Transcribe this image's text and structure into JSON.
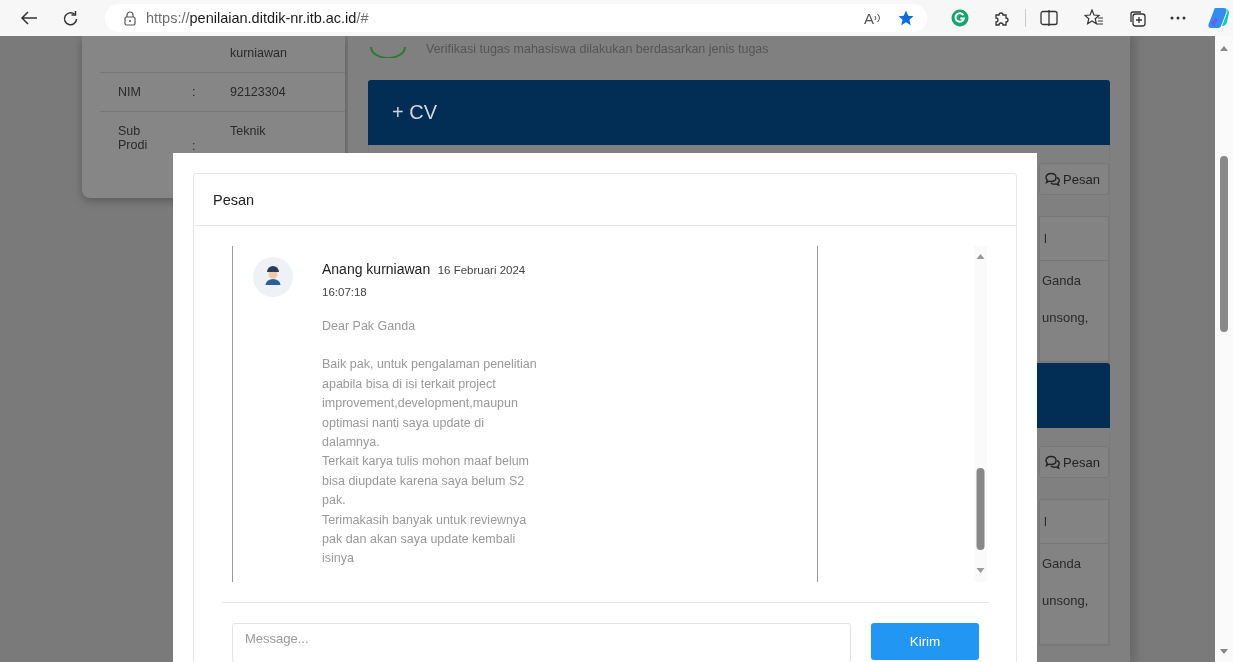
{
  "browser": {
    "url_scheme": "https://",
    "url_host": "penilaian.ditdik-nr.itb.ac.id",
    "url_path": "/#",
    "read_aloud_glyph": "A",
    "favorite": true
  },
  "profile_card": {
    "rows": [
      {
        "value": "kurniawan"
      },
      {
        "label": "NIM",
        "separator": ":",
        "value": "92123304"
      },
      {
        "label": "Sub Prodi",
        "separator": ":",
        "value": "Teknik"
      }
    ]
  },
  "verification": {
    "text": "Verifikasi tugas mahasiswa dilakukan berdasarkan jenis tugas"
  },
  "sections": [
    {
      "title": "+ CV",
      "message_button": "Pesan",
      "cells": [
        "l",
        "Ganda",
        "unsong,"
      ]
    },
    {
      "message_button": "Pesan",
      "cells": [
        "l",
        "Ganda",
        "unsong,"
      ]
    }
  ],
  "modal": {
    "title": "Pesan",
    "messages": [
      {
        "sender": "Anang kurniawan",
        "date": "16 Februari 2024",
        "time": "16:07:18",
        "paragraphs": [
          "Dear Pak Ganda",
          "Baik pak, untuk pengalaman penelitian apabila bisa di isi terkait project improvement,development,maupun optimasi nanti saya update di dalamnya.\nTerkait karya tulis mohon maaf belum bisa diupdate karena saya belum S2 pak.\nTerimakasih banyak untuk reviewnya pak dan akan saya update kembali isinya"
        ]
      }
    ],
    "input": {
      "placeholder": "Message..."
    },
    "send_button": "Kirim"
  }
}
